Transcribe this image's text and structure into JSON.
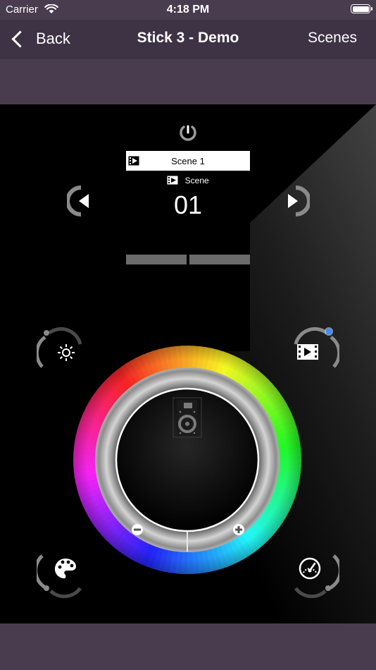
{
  "status_bar": {
    "carrier": "Carrier",
    "time": "4:18 PM"
  },
  "nav": {
    "back_label": "Back",
    "title": "Stick 3 - Demo",
    "scenes_label": "Scenes"
  },
  "scene": {
    "name": "Scene 1",
    "caption": "Scene",
    "number": "01"
  },
  "colors": {
    "chrome": "#493c4e",
    "nav_bar": "#3e3345",
    "background": "#000000",
    "active_dot": "#3e8cff",
    "control_grey": "#8a8a8a"
  },
  "icons": {
    "power": "power-icon",
    "prev": "previous-icon",
    "next": "next-icon",
    "brightness": "sun-icon",
    "scene_mode": "film-icon",
    "palette": "palette-icon",
    "speed": "speedometer-icon",
    "minus": "minus-icon",
    "plus": "plus-icon",
    "center": "speaker-icon"
  }
}
